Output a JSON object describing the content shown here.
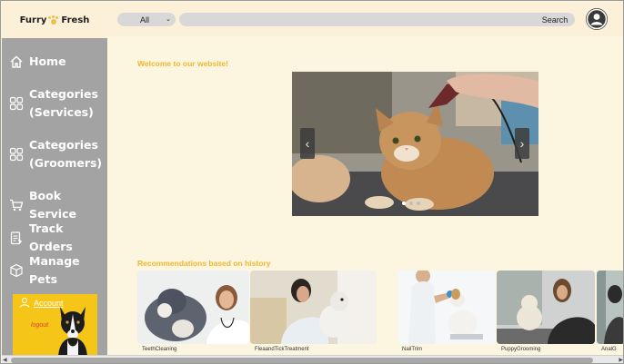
{
  "brand": {
    "name_left": "Furry",
    "name_right": "Fresh"
  },
  "sidebar": {
    "items": [
      {
        "label": "Home",
        "icon": "home-icon"
      },
      {
        "label": "Categories\n(Services)",
        "icon": "grid-icon"
      },
      {
        "label": "Categories\n(Groomers)",
        "icon": "grid-icon"
      },
      {
        "label": "Book Service",
        "icon": "cart-icon"
      },
      {
        "label": "Track Orders",
        "icon": "clipboard-icon"
      },
      {
        "label": "Manage Pets",
        "icon": "box-icon"
      }
    ],
    "account": {
      "label": "Account",
      "logout": "logout",
      "icon": "user-icon"
    }
  },
  "search": {
    "category_value": "All",
    "placeholder": "",
    "button_label": "Search"
  },
  "main": {
    "welcome": "Welcome to our website!",
    "carousel": {
      "prev": "‹",
      "next": "›",
      "slide_count": 3,
      "active_slide": 1
    },
    "recommendations_title": "Recommendations based on history",
    "recommendations": [
      {
        "caption": "TeethCleaning"
      },
      {
        "caption": "FleaandTickTreatment"
      },
      {
        "caption": "NailTrim"
      },
      {
        "caption": "PuppyGrooming"
      },
      {
        "caption": "AnalG"
      }
    ]
  },
  "colors": {
    "accent": "#f0b62c",
    "sidebar": "#a3a3a3",
    "background": "#fcf6e1",
    "account_card": "#f5c518"
  }
}
